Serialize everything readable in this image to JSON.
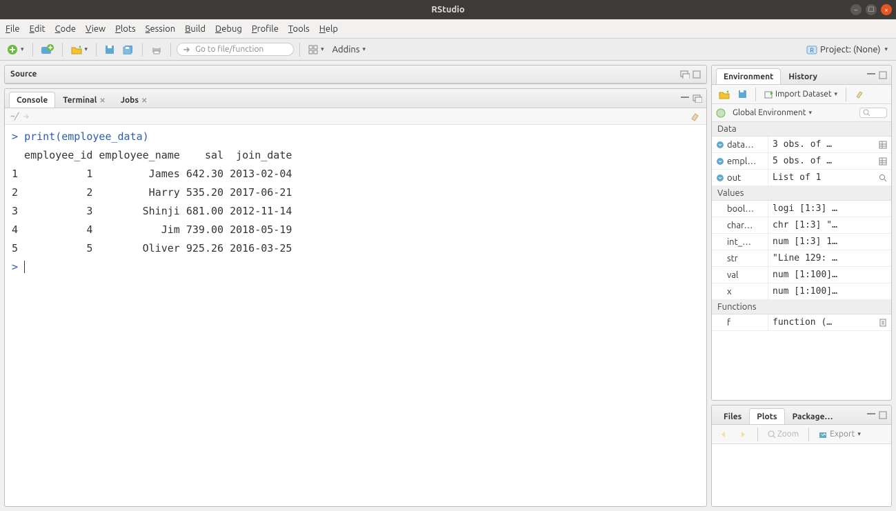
{
  "window": {
    "title": "RStudio"
  },
  "menu": [
    "File",
    "Edit",
    "Code",
    "View",
    "Plots",
    "Session",
    "Build",
    "Debug",
    "Profile",
    "Tools",
    "Help"
  ],
  "toolbar": {
    "goto_placeholder": "Go to file/function",
    "addins_label": "Addins",
    "project_label": "Project: (None)"
  },
  "source_pane": {
    "title": "Source"
  },
  "console_tabs": [
    "Console",
    "Terminal",
    "Jobs"
  ],
  "console_active": "Console",
  "console_path": "~/",
  "console": {
    "prompts": [
      {
        "prompt": ">",
        "code": "print(employee_data)"
      }
    ],
    "output_header": "  employee_id employee_name    sal  join_date",
    "output_rows": [
      "1           1         James 642.30 2013-02-04",
      "2           2         Harry 535.20 2017-06-21",
      "3           3        Shinji 681.00 2012-11-14",
      "4           4           Jim 739.00 2018-05-19",
      "5           5        Oliver 925.26 2016-03-25"
    ],
    "trailing_prompt": ">"
  },
  "env_tabs": [
    "Environment",
    "History"
  ],
  "env_active": "Environment",
  "env_toolbar": {
    "import_label": "Import Dataset",
    "scope_label": "Global Environment"
  },
  "env": {
    "sections": [
      {
        "title": "Data",
        "rows": [
          {
            "name": "data…",
            "val": "3 obs. of …",
            "icon": "expand",
            "grid": true
          },
          {
            "name": "empl…",
            "val": "5 obs. of …",
            "icon": "expand",
            "grid": true
          },
          {
            "name": "out",
            "val": "List of 1",
            "icon": "expand",
            "search": true
          }
        ]
      },
      {
        "title": "Values",
        "rows": [
          {
            "name": "bool…",
            "val": "logi [1:3] …"
          },
          {
            "name": "char…",
            "val": "chr [1:3] \"…"
          },
          {
            "name": "int_…",
            "val": "num [1:3] 1…"
          },
          {
            "name": "str",
            "val": "\"Line 129: …"
          },
          {
            "name": "val",
            "val": "num [1:100]…"
          },
          {
            "name": "x",
            "val": "num [1:100]…"
          }
        ]
      },
      {
        "title": "Functions",
        "rows": [
          {
            "name": "f",
            "val": "function (…",
            "sheet": true
          }
        ]
      }
    ]
  },
  "bottom_tabs": [
    "Files",
    "Plots",
    "Package…"
  ],
  "bottom_active": "Plots",
  "plot_toolbar": {
    "zoom": "Zoom",
    "export": "Export"
  }
}
